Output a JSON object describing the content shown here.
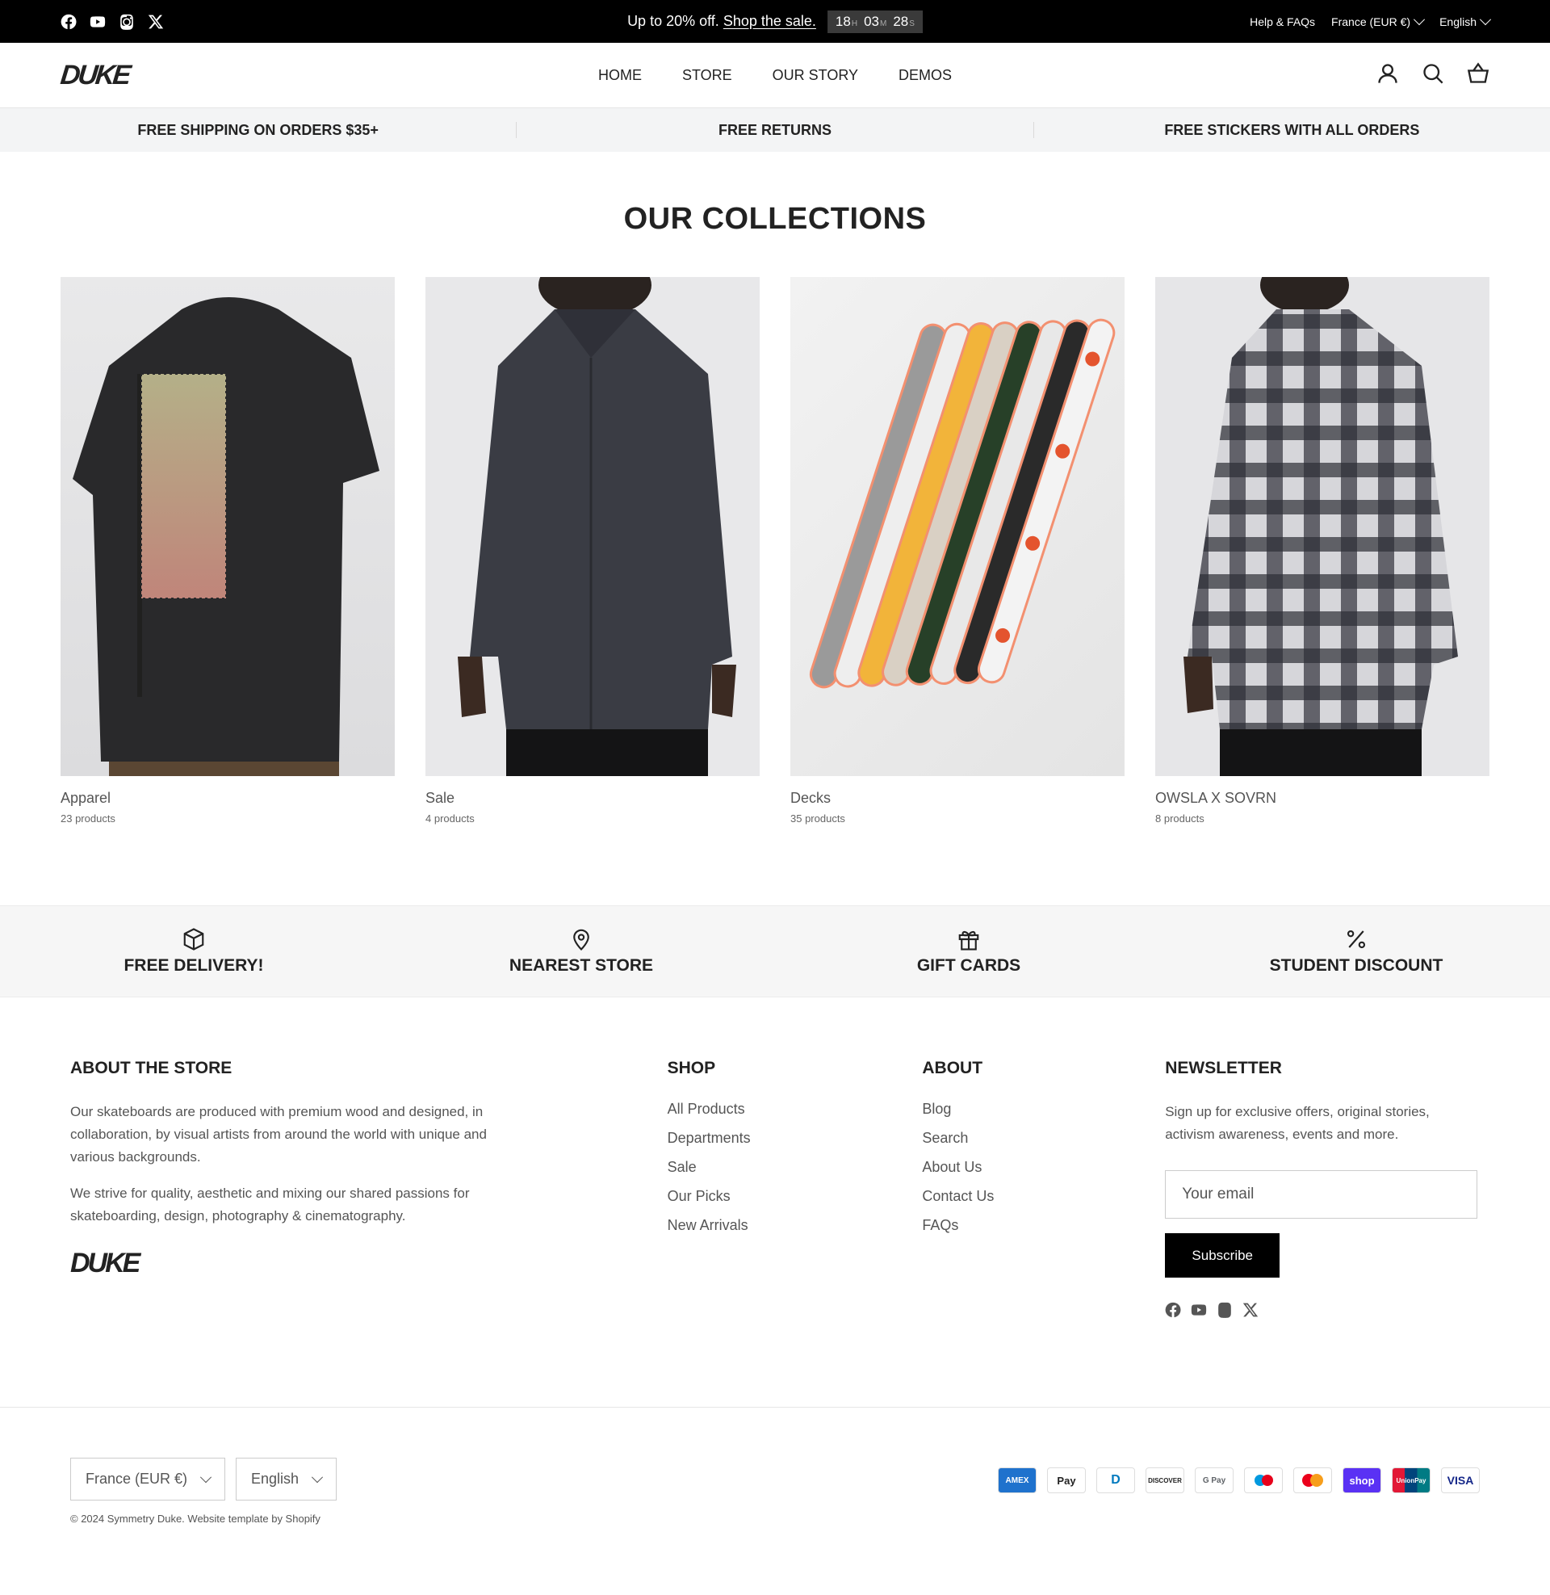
{
  "topbar": {
    "promo_text": "Up to 20% off.",
    "promo_link": "Shop the sale.",
    "countdown": {
      "hours": "18",
      "hours_unit": "H",
      "minutes": "03",
      "minutes_unit": "M",
      "seconds": "28",
      "seconds_unit": "S"
    },
    "help": "Help & FAQs",
    "country": "France (EUR €)",
    "language": "English",
    "social_icons": [
      "facebook-icon",
      "youtube-icon",
      "instagram-icon",
      "x-icon"
    ]
  },
  "header": {
    "logo": "DUKE",
    "nav": [
      "HOME",
      "STORE",
      "OUR STORY",
      "DEMOS"
    ],
    "icons": [
      "account-icon",
      "search-icon",
      "cart-icon"
    ]
  },
  "usp": [
    "FREE SHIPPING ON ORDERS $35+",
    "FREE RETURNS",
    "FREE STICKERS WITH ALL ORDERS"
  ],
  "collections": {
    "title": "OUR COLLECTIONS",
    "items": [
      {
        "name": "Apparel",
        "count": "23 products"
      },
      {
        "name": "Sale",
        "count": "4 products"
      },
      {
        "name": "Decks",
        "count": "35 products"
      },
      {
        "name": "OWSLA X SOVRN",
        "count": "8 products"
      }
    ]
  },
  "features": [
    {
      "label": "FREE DELIVERY!",
      "icon": "box-icon"
    },
    {
      "label": "NEAREST STORE",
      "icon": "location-pin-icon"
    },
    {
      "label": "GIFT CARDS",
      "icon": "gift-icon"
    },
    {
      "label": "STUDENT DISCOUNT",
      "icon": "percent-icon"
    }
  ],
  "footer": {
    "about": {
      "title": "ABOUT THE STORE",
      "p1": "Our skateboards are produced with premium wood and designed, in collaboration, by visual artists from around the world with unique and various backgrounds.",
      "p2": "We strive for quality, aesthetic and mixing our shared passions for skateboarding, design, photography & cinematography.",
      "logo": "DUKE"
    },
    "shop": {
      "title": "SHOP",
      "links": [
        "All Products",
        "Departments",
        "Sale",
        "Our Picks",
        "New Arrivals"
      ]
    },
    "about_links": {
      "title": "ABOUT",
      "links": [
        "Blog",
        "Search",
        "About Us",
        "Contact Us",
        "FAQs"
      ]
    },
    "newsletter": {
      "title": "NEWSLETTER",
      "text": "Sign up for exclusive offers, original stories, activism awareness, events and more.",
      "email_placeholder": "Your email",
      "button": "Subscribe"
    }
  },
  "bottom": {
    "country": "France (EUR €)",
    "language": "English",
    "payments": [
      "AMEX",
      "Pay",
      "D",
      "DISCOVER",
      "G Pay",
      "",
      "",
      "shop",
      "UnionPay",
      "VISA"
    ],
    "copyright": "© 2024 Symmetry Duke. Website template by Shopify"
  }
}
